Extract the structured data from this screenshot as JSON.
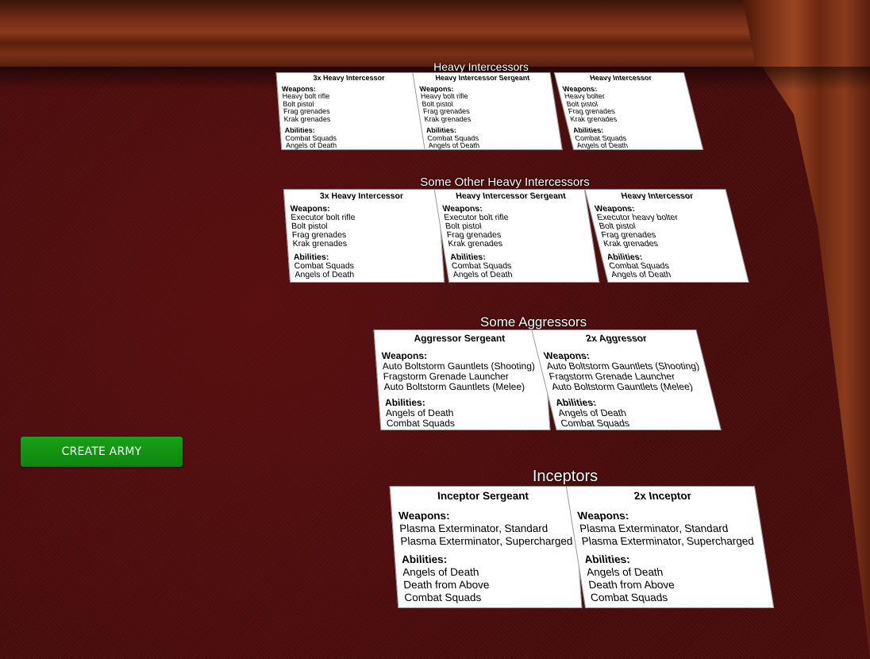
{
  "button": {
    "label": "CREATE ARMY",
    "color": "#119111"
  },
  "groups": [
    {
      "title": "Heavy Intercessors",
      "cards": [
        {
          "name": "3x Heavy Intercessor",
          "weapons_label": "Weapons:",
          "weapons": [
            "Heavy bolt rifle",
            "Bolt pistol",
            "Frag grenades",
            "Krak grenades"
          ],
          "abilities_label": "Abilities:",
          "abilities": [
            "Combat Squads",
            "Angels of Death"
          ]
        },
        {
          "name": "Heavy Intercessor Sergeant",
          "weapons_label": "Weapons:",
          "weapons": [
            "Heavy bolt rifle",
            "Bolt pistol",
            "Frag grenades",
            "Krak grenades"
          ],
          "abilities_label": "Abilities:",
          "abilities": [
            "Combat Squads",
            "Angels of Death"
          ]
        },
        {
          "name": "Heavy Intercessor",
          "weapons_label": "Weapons:",
          "weapons": [
            "Heavy bolter",
            "Bolt pistol",
            "Frag grenades",
            "Krak grenades"
          ],
          "abilities_label": "Abilities:",
          "abilities": [
            "Combat Squads",
            "Angels of Death"
          ]
        }
      ]
    },
    {
      "title": "Some Other Heavy Intercessors",
      "cards": [
        {
          "name": "3x Heavy Intercessor",
          "weapons_label": "Weapons:",
          "weapons": [
            "Executor bolt rifle",
            "Bolt pistol",
            "Frag grenades",
            "Krak grenades"
          ],
          "abilities_label": "Abilities:",
          "abilities": [
            "Combat Squads",
            "Angels of Death"
          ]
        },
        {
          "name": "Heavy Intercessor Sergeant",
          "weapons_label": "Weapons:",
          "weapons": [
            "Executor bolt rifle",
            "Bolt pistol",
            "Frag grenades",
            "Krak grenades"
          ],
          "abilities_label": "Abilities:",
          "abilities": [
            "Combat Squads",
            "Angels of Death"
          ]
        },
        {
          "name": "Heavy Intercessor",
          "weapons_label": "Weapons:",
          "weapons": [
            "Executor heavy bolter",
            "Bolt pistol",
            "Frag grenades",
            "Krak grenades"
          ],
          "abilities_label": "Abilities:",
          "abilities": [
            "Combat Squads",
            "Angels of Death"
          ]
        }
      ]
    },
    {
      "title": "Some Aggressors",
      "cards": [
        {
          "name": "Aggressor Sergeant",
          "weapons_label": "Weapons:",
          "weapons": [
            "Auto Boltstorm Gauntlets (Shooting)",
            "Fragstorm Grenade Launcher",
            "Auto Boltstorm Gauntlets (Melee)"
          ],
          "abilities_label": "Abilities:",
          "abilities": [
            "Angels of Death",
            "Combat Squads"
          ]
        },
        {
          "name": "2x Aggressor",
          "weapons_label": "Weapons:",
          "weapons": [
            "Auto Boltstorm Gauntlets (Shooting)",
            "Fragstorm Grenade Launcher",
            "Auto Boltstorm Gauntlets (Melee)"
          ],
          "abilities_label": "Abilities:",
          "abilities": [
            "Angels of Death",
            "Combat Squads"
          ]
        }
      ]
    },
    {
      "title": "Inceptors",
      "cards": [
        {
          "name": "Inceptor Sergeant",
          "weapons_label": "Weapons:",
          "weapons": [
            "Plasma Exterminator, Standard",
            "Plasma Exterminator, Supercharged"
          ],
          "abilities_label": "Abilities:",
          "abilities": [
            "Angels of Death",
            "Death from Above",
            "Combat Squads"
          ]
        },
        {
          "name": "2x Inceptor",
          "weapons_label": "Weapons:",
          "weapons": [
            "Plasma Exterminator, Standard",
            "Plasma Exterminator, Supercharged"
          ],
          "abilities_label": "Abilities:",
          "abilities": [
            "Angels of Death",
            "Death from Above",
            "Combat Squads"
          ]
        }
      ]
    }
  ]
}
